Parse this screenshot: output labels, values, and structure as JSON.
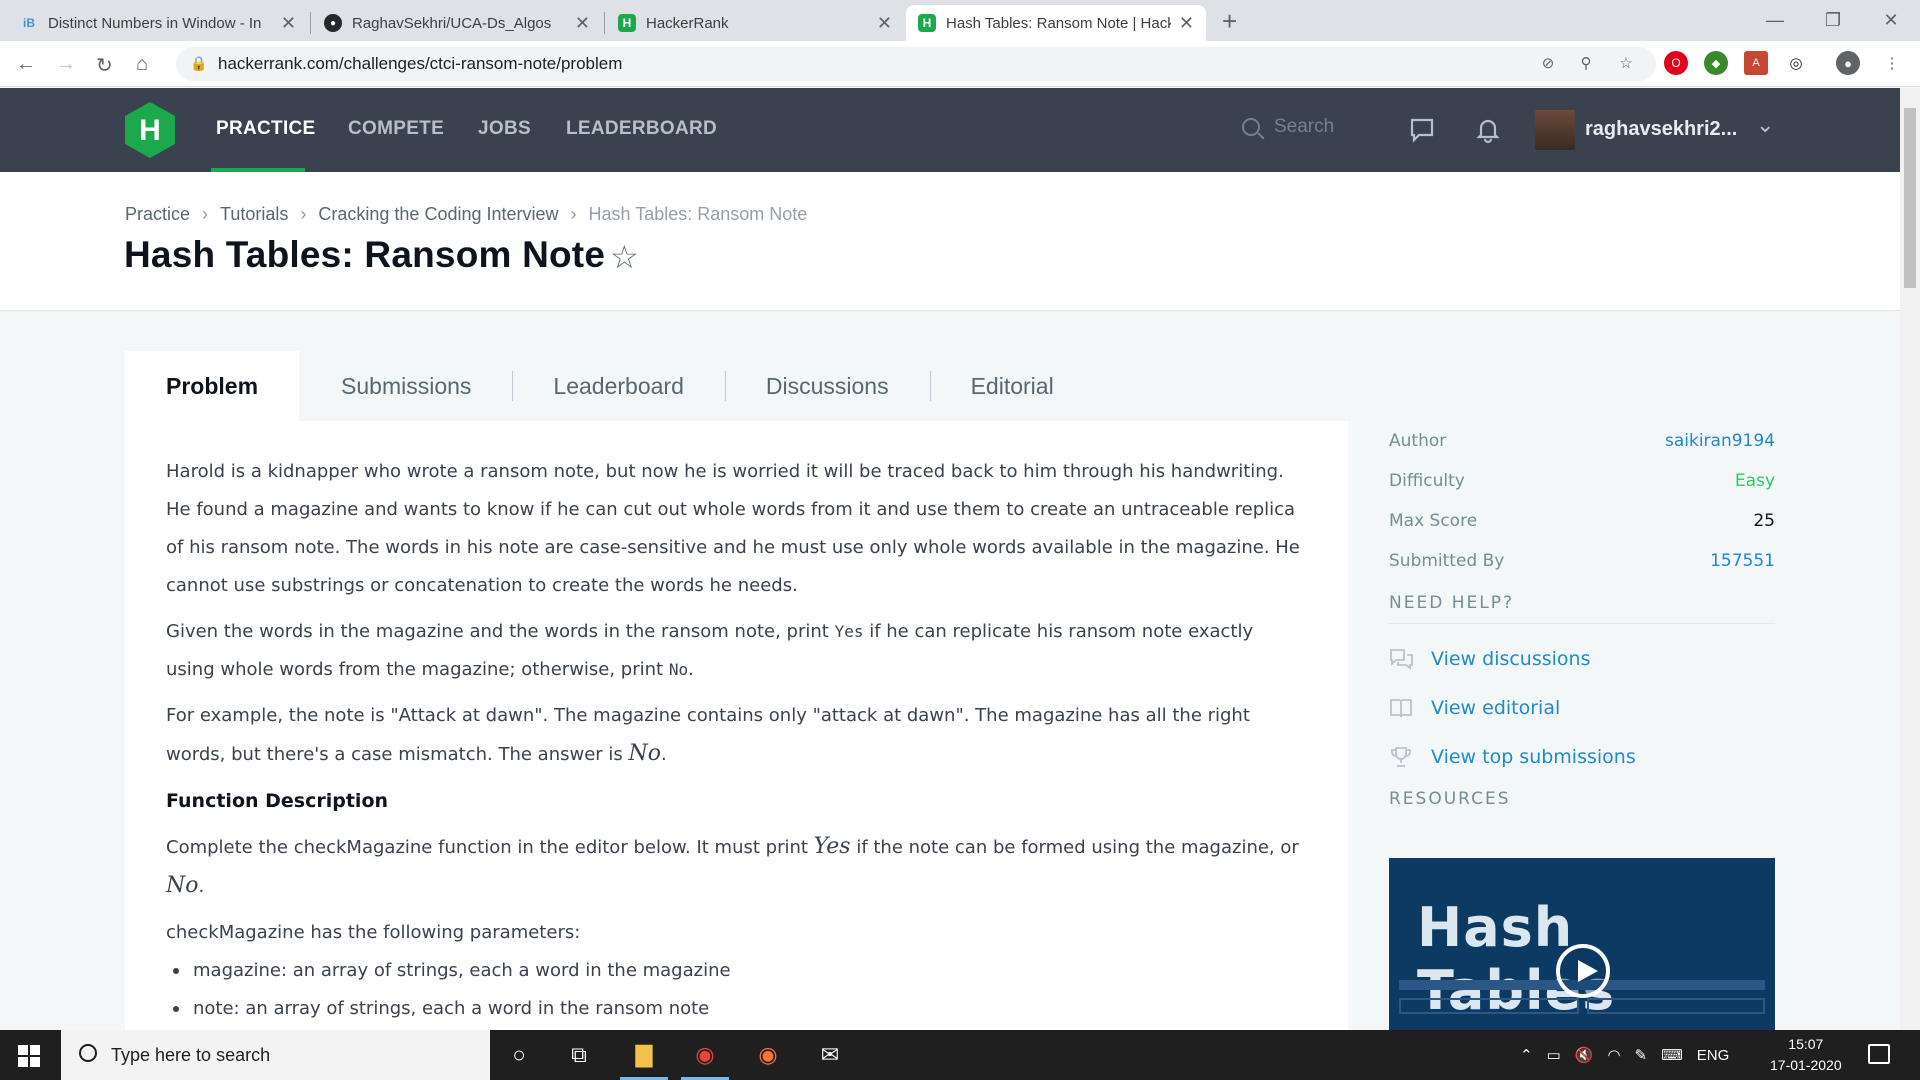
{
  "browser": {
    "tabs": [
      {
        "title": "Distinct Numbers in Window - In",
        "favicon": "ib-icon"
      },
      {
        "title": "RaghavSekhri/UCA-Ds_Algos",
        "favicon": "github-icon"
      },
      {
        "title": "HackerRank",
        "favicon": "hackerrank-icon"
      },
      {
        "title": "Hash Tables: Ransom Note | Hack",
        "favicon": "hackerrank-icon",
        "active": true
      }
    ],
    "url": "hackerrank.com/challenges/ctci-ransom-note/problem"
  },
  "nav": {
    "logo": "H",
    "items": [
      "PRACTICE",
      "COMPETE",
      "JOBS",
      "LEADERBOARD"
    ],
    "search_placeholder": "Search",
    "username": "raghavsekhri2..."
  },
  "header": {
    "breadcrumbs": [
      "Practice",
      "Tutorials",
      "Cracking the Coding Interview",
      "Hash Tables: Ransom Note"
    ],
    "title": "Hash Tables: Ransom Note"
  },
  "problem_tabs": [
    "Problem",
    "Submissions",
    "Leaderboard",
    "Discussions",
    "Editorial"
  ],
  "problem": {
    "p1": "Harold is a kidnapper who wrote a ransom note, but now he is worried it will be traced back to him through his handwriting. He found a magazine and wants to know if he can cut out whole words from it and use them to create an untraceable replica of his ransom note. The words in his note are case-sensitive and he must use only whole words available in the magazine. He cannot use substrings or concatenation to create the words he needs.",
    "p2_a": "Given the words in the magazine and the words in the ransom note, print ",
    "p2_yes": "Yes",
    "p2_b": " if he can replicate his ransom note exactly using whole words from the magazine; otherwise, print ",
    "p2_no": "No",
    "p2_c": ".",
    "p3_a": "For example, the note is \"Attack at dawn\". The magazine contains only \"attack at dawn\". The magazine has all the right words, but there's a case mismatch. The answer is ",
    "p3_no": "No",
    "p3_c": ".",
    "fd_heading": "Function Description",
    "p4_a": "Complete the checkMagazine function in the editor below. It must print ",
    "p4_yes": "Yes",
    "p4_b": " if the note can be formed using the magazine, or ",
    "p4_no": "No",
    "p4_c": ".",
    "params_intro": "checkMagazine has the following parameters:",
    "params": [
      "magazine: an array of strings, each a word in the magazine",
      "note: an array of strings, each a word in the ransom note"
    ]
  },
  "sidebar": {
    "details": [
      {
        "label": "Author",
        "value": "saikiran9194"
      },
      {
        "label": "Difficulty",
        "value": "Easy"
      },
      {
        "label": "Max Score",
        "value": "25"
      },
      {
        "label": "Submitted By",
        "value": "157551"
      }
    ],
    "need_help_heading": "NEED HELP?",
    "help_links": [
      "View discussions",
      "View editorial",
      "View top submissions"
    ],
    "resources_heading": "RESOURCES",
    "video_title": "Hash Tables"
  },
  "taskbar": {
    "search_placeholder": "Type here to search",
    "language": "ENG",
    "time": "15:07",
    "date": "17-01-2020"
  }
}
